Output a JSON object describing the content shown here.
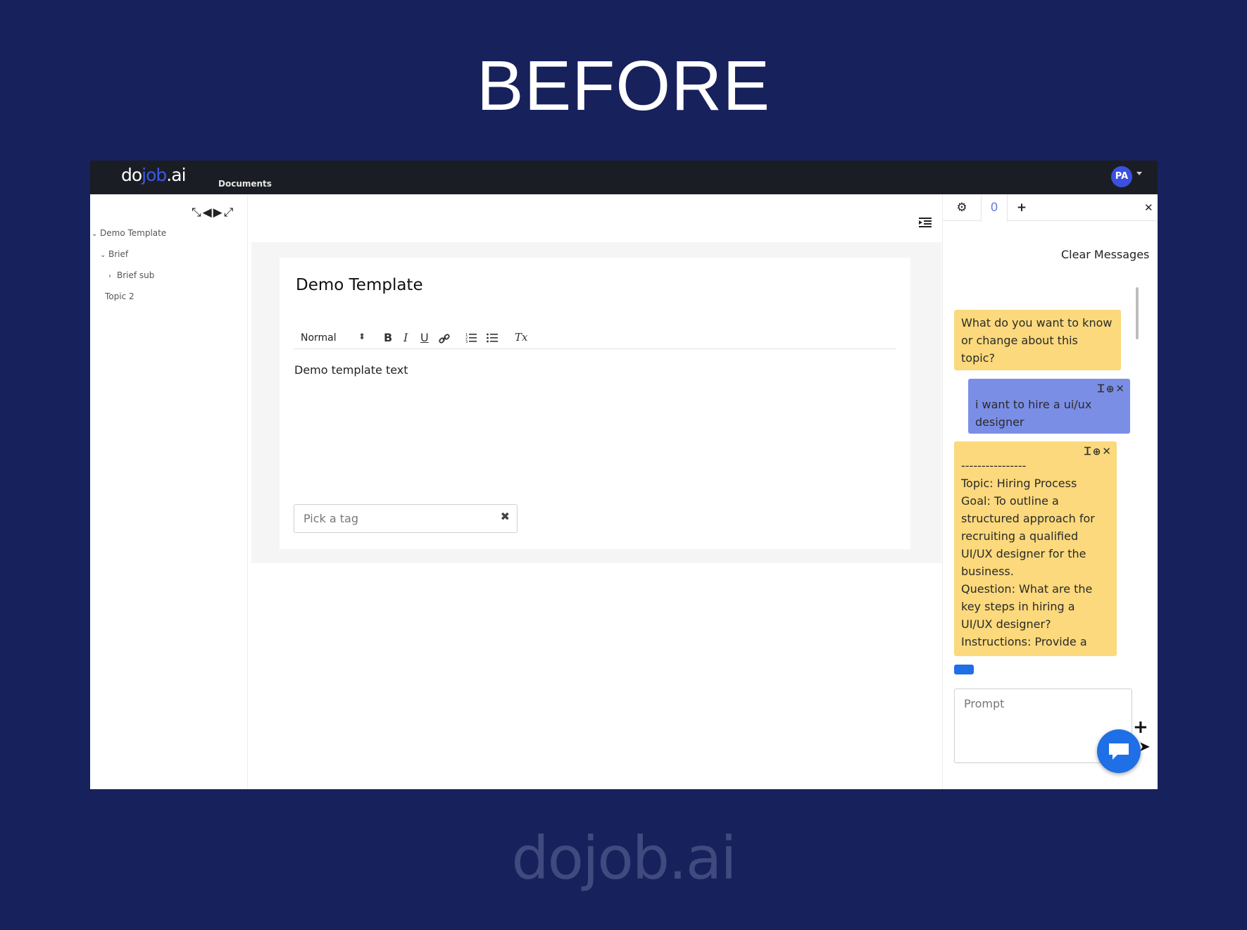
{
  "hero": {
    "title": "BEFORE"
  },
  "footer": {
    "logo_left": "do",
    "logo_mid": "job",
    "logo_right": ".ai"
  },
  "app": {
    "brand": {
      "left": "do",
      "mid": "job",
      "right": ".ai"
    },
    "nav": {
      "documents": "Documents"
    },
    "user": {
      "initials": "PA"
    }
  },
  "sidebar": {
    "controls": "⤡◀▶⤢",
    "tree": [
      {
        "label": "Demo Template",
        "chevron": "⌄"
      },
      {
        "label": "Brief",
        "chevron": "⌄"
      },
      {
        "label": "Brief sub",
        "chevron": "›"
      },
      {
        "label": "Topic 2",
        "chevron": ""
      }
    ]
  },
  "editor": {
    "title": "Demo Template",
    "format_select": "Normal",
    "format_arrows": "⬍",
    "tools": {
      "bold": "B",
      "italic": "I",
      "underline": "U",
      "link": "🔗",
      "ordered_list": "☰",
      "bullet_list": "☰",
      "clear_format": "Tx"
    },
    "body": "Demo template text",
    "tag_placeholder": "Pick a tag",
    "tag_clear": "✖"
  },
  "chat": {
    "tabs": {
      "settings": "⚙",
      "count": "0",
      "add": "+"
    },
    "close": "✕",
    "clear_messages": "Clear Messages",
    "messages": [
      {
        "role": "assistant",
        "text": "What do you want to know or change about this topic?"
      },
      {
        "role": "user",
        "text": "i want to hire a ui/ux designer"
      },
      {
        "role": "assistant",
        "lines": [
          "----------------",
          "Topic: Hiring Process",
          "Goal: To outline a structured approach for recruiting a qualified UI/UX designer for the business.",
          "Question: What are the key steps in hiring a UI/UX designer?",
          "Instructions: Provide a"
        ]
      }
    ],
    "actions": {
      "cursor": "Ꮖ",
      "plus": "⊕",
      "close": "✕"
    },
    "prompt_placeholder": "Prompt",
    "plus_button": "+",
    "send_icon": "➤"
  },
  "colors": {
    "background": "#17215c",
    "accent": "#3b59e6",
    "assistant_bubble": "#fbd97c",
    "user_bubble": "#7b8ee6",
    "fab": "#1f6fe6"
  }
}
